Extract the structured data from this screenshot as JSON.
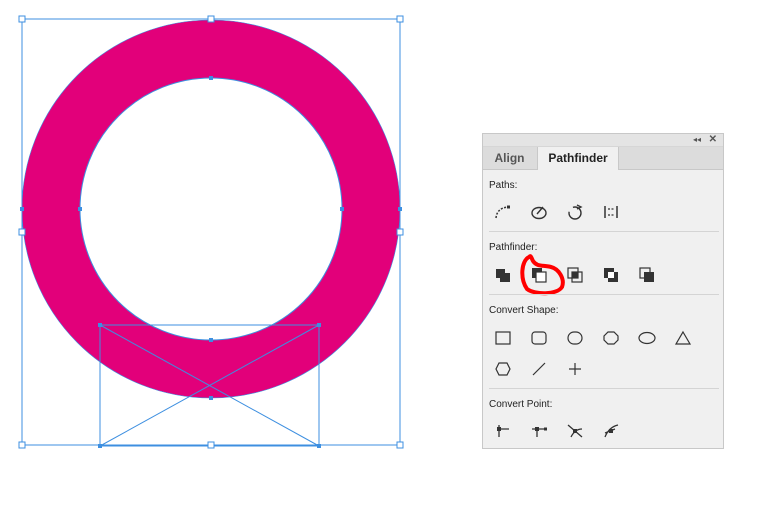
{
  "panel": {
    "tabs": [
      "Align",
      "Pathfinder"
    ],
    "active_tab": "Pathfinder",
    "collapse_glyph": "◂◂",
    "close_glyph": "✕",
    "sections": {
      "paths": {
        "label": "Paths:"
      },
      "pathfinder": {
        "label": "Pathfinder:"
      },
      "convert_shape": {
        "label": "Convert Shape:"
      },
      "convert_point": {
        "label": "Convert Point:"
      }
    }
  },
  "annotation": {
    "highlighted_button": "minus-front",
    "color": "#ff0000"
  },
  "colors": {
    "ring_fill": "#e2007a",
    "selection": "#3d8fe0",
    "panel_bg": "#f0f0f0"
  },
  "icons": {
    "paths": [
      "open-path-icon",
      "close-path-icon",
      "reverse-direction-icon",
      "join-icon"
    ],
    "pathfinder": [
      "unite-icon",
      "minus-front-icon",
      "intersect-icon",
      "exclude-icon",
      "minus-back-icon"
    ],
    "convert_shape": [
      "rectangle-icon",
      "rounded-rectangle-icon",
      "ellipse-shape-icon",
      "polygon-icon",
      "oval-icon",
      "triangle-icon",
      "hexagon-icon",
      "line-icon",
      "cross-icon"
    ],
    "convert_point": [
      "corner-point-icon",
      "smooth-point-icon",
      "symmetric-point-icon",
      "asymmetric-point-icon"
    ]
  }
}
